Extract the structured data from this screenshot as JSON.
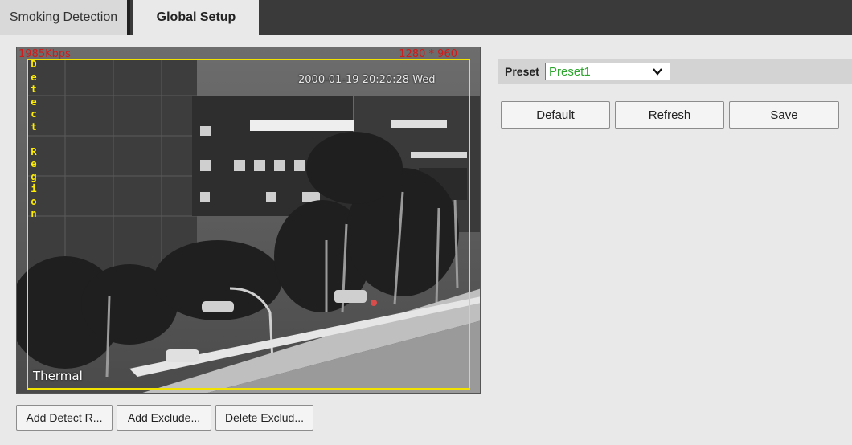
{
  "tabs": [
    {
      "label": "Smoking Detection"
    },
    {
      "label": "Global Setup"
    }
  ],
  "video": {
    "bitrate": "1985Kbps",
    "resolution": "1280 * 960",
    "timestamp": "2000-01-19 20:20:28 Wed",
    "channel_label": "Thermal",
    "region_label": [
      "D",
      "e",
      "t",
      "e",
      "c",
      "t",
      "",
      "R",
      "e",
      "g",
      "i",
      "o",
      "n"
    ]
  },
  "buttons": {
    "add_detect": "Add Detect R...",
    "add_exclude": "Add Exclude...",
    "delete_exclude": "Delete Exclud..."
  },
  "preset": {
    "label": "Preset",
    "value": "Preset1",
    "value_color": "#2ba52b"
  },
  "actions": {
    "default": "Default",
    "refresh": "Refresh",
    "save": "Save"
  },
  "colors": {
    "osd_red": "#d21a1a",
    "region_yellow": "#f2e200"
  }
}
